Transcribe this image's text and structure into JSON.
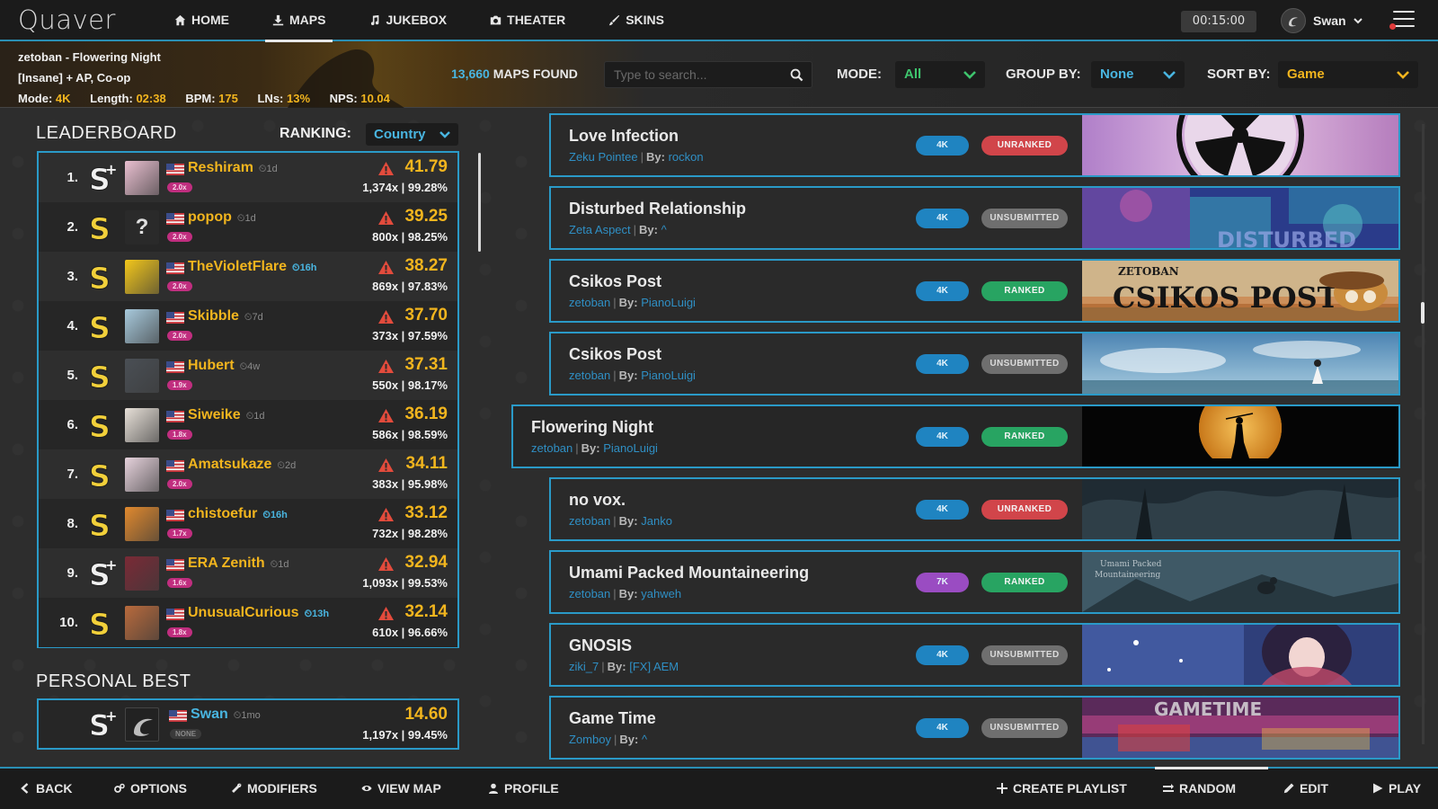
{
  "nav": {
    "logo": "Quaver",
    "items": [
      {
        "label": "HOME",
        "icon": "home-icon"
      },
      {
        "label": "MAPS",
        "icon": "download-icon"
      },
      {
        "label": "JUKEBOX",
        "icon": "music-icon"
      },
      {
        "label": "THEATER",
        "icon": "camera-icon"
      },
      {
        "label": "SKINS",
        "icon": "brush-icon"
      }
    ],
    "active": "MAPS",
    "timer": "00:15:00",
    "username": "Swan"
  },
  "map_info": {
    "title": "zetoban - Flowering Night",
    "difficulty": "[Insane] + AP, Co-op",
    "mode_label": "Mode:",
    "mode": "4K",
    "length_label": "Length:",
    "length": "02:38",
    "bpm_label": "BPM:",
    "bpm": "175",
    "lns_label": "LNs:",
    "lns": "13%",
    "nps_label": "NPS:",
    "nps": "10.04"
  },
  "filters": {
    "maps_found_count": "13,660",
    "maps_found_label": "MAPS FOUND",
    "search_placeholder": "Type to search...",
    "mode_label": "MODE:",
    "mode_value": "All",
    "group_label": "GROUP BY:",
    "group_value": "None",
    "sort_label": "SORT BY:",
    "sort_value": "Game"
  },
  "leaderboard": {
    "title": "LEADERBOARD",
    "ranking_label": "RANKING:",
    "ranking_value": "Country",
    "rows": [
      {
        "pos": "1.",
        "grade": "S+",
        "name": "Reshiram",
        "time": "1d",
        "time_hi": false,
        "mod": "2.0x",
        "score": "41.79",
        "acc": "1,374x | 99.28%",
        "avatar": "#e9bfd0"
      },
      {
        "pos": "2.",
        "grade": "S",
        "name": "popop",
        "time": "1d",
        "time_hi": false,
        "mod": "2.0x",
        "score": "39.25",
        "acc": "800x | 98.25%",
        "avatar": "unknown"
      },
      {
        "pos": "3.",
        "grade": "S",
        "name": "TheVioletFlare",
        "time": "16h",
        "time_hi": true,
        "mod": "2.0x",
        "score": "38.27",
        "acc": "869x | 97.83%",
        "avatar": "#f3c71b"
      },
      {
        "pos": "4.",
        "grade": "S",
        "name": "Skibble",
        "time": "7d",
        "time_hi": false,
        "mod": "2.0x",
        "score": "37.70",
        "acc": "373x | 97.59%",
        "avatar": "#a7c9dc"
      },
      {
        "pos": "5.",
        "grade": "S",
        "name": "Hubert",
        "time": "4w",
        "time_hi": false,
        "mod": "1.9x",
        "score": "37.31",
        "acc": "550x | 98.17%",
        "avatar": "#4a4f55"
      },
      {
        "pos": "6.",
        "grade": "S",
        "name": "Siweike",
        "time": "1d",
        "time_hi": false,
        "mod": "1.8x",
        "score": "36.19",
        "acc": "586x | 98.59%",
        "avatar": "#e7e0d8"
      },
      {
        "pos": "7.",
        "grade": "S",
        "name": "Amatsukaze",
        "time": "2d",
        "time_hi": false,
        "mod": "2.0x",
        "score": "34.11",
        "acc": "383x | 95.98%",
        "avatar": "#e6d2dc"
      },
      {
        "pos": "8.",
        "grade": "S",
        "name": "chistoefur",
        "time": "16h",
        "time_hi": true,
        "mod": "1.7x",
        "score": "33.12",
        "acc": "732x | 98.28%",
        "avatar": "#e0892e"
      },
      {
        "pos": "9.",
        "grade": "S+",
        "name": "ERA Zenith",
        "time": "1d",
        "time_hi": false,
        "mod": "1.6x",
        "score": "32.94",
        "acc": "1,093x | 99.53%",
        "avatar": "#7a2a36"
      },
      {
        "pos": "10.",
        "grade": "S",
        "name": "UnusualCurious",
        "time": "13h",
        "time_hi": true,
        "mod": "1.8x",
        "score": "32.14",
        "acc": "610x | 96.66%",
        "avatar": "#b86a3c"
      }
    ]
  },
  "personal_best": {
    "title": "PERSONAL BEST",
    "grade": "S+",
    "name": "Swan",
    "time": "1mo",
    "mod": "NONE",
    "score": "14.60",
    "acc": "1,197x | 99.45%"
  },
  "maps": [
    {
      "title": "Love Infection",
      "artist": "Zeku Pointee",
      "by_label": "By:",
      "creator": "rockon",
      "keys": "4K",
      "status": "UNRANKED",
      "banner": "radiation"
    },
    {
      "title": "Disturbed Relationship",
      "artist": "Zeta Aspect",
      "by_label": "By:",
      "creator": "^",
      "keys": "4K",
      "status": "UNSUBMITTED",
      "banner": "disturbed"
    },
    {
      "title": "Csikos Post",
      "artist": "zetoban",
      "by_label": "By:",
      "creator": "PianoLuigi",
      "keys": "4K",
      "status": "RANKED",
      "banner": "csikos",
      "banner_text_top": "ZETOBAN",
      "banner_text_main": "CSIKOS POST"
    },
    {
      "title": "Csikos Post",
      "artist": "zetoban",
      "by_label": "By:",
      "creator": "PianoLuigi",
      "keys": "4K",
      "status": "UNSUBMITTED",
      "banner": "sky"
    },
    {
      "title": "Flowering Night",
      "artist": "zetoban",
      "by_label": "By:",
      "creator": "PianoLuigi",
      "keys": "4K",
      "status": "RANKED",
      "banner": "moon",
      "selected": true
    },
    {
      "title": "no vox.",
      "artist": "zetoban",
      "by_label": "By:",
      "creator": "Janko",
      "keys": "4K",
      "status": "UNRANKED",
      "banner": "forest"
    },
    {
      "title": "Umami Packed Mountaineering",
      "artist": "zetoban",
      "by_label": "By:",
      "creator": "yahweh",
      "keys": "7K",
      "status": "RANKED",
      "banner": "mountain"
    },
    {
      "title": "GNOSIS",
      "artist": "ziki_7",
      "by_label": "By:",
      "creator": "[FX] AEM",
      "keys": "4K",
      "status": "UNSUBMITTED",
      "banner": "anime"
    },
    {
      "title": "Game Time",
      "artist": "Zomboy",
      "by_label": "By:",
      "creator": "^",
      "keys": "4K",
      "status": "UNSUBMITTED",
      "banner": "gametime",
      "banner_text_main": "GAMETIME"
    }
  ],
  "bottom": {
    "left": [
      {
        "label": "BACK",
        "icon": "chevron-left-icon"
      },
      {
        "label": "OPTIONS",
        "icon": "gears-icon"
      },
      {
        "label": "MODIFIERS",
        "icon": "wrench-icon"
      },
      {
        "label": "VIEW MAP",
        "icon": "eye-icon"
      },
      {
        "label": "PROFILE",
        "icon": "user-icon"
      }
    ],
    "right": [
      {
        "label": "CREATE PLAYLIST",
        "icon": "plus-icon"
      },
      {
        "label": "RANDOM",
        "icon": "shuffle-icon"
      },
      {
        "label": "EDIT",
        "icon": "pencil-icon"
      },
      {
        "label": "PLAY",
        "icon": "play-icon"
      }
    ]
  },
  "colors": {
    "accent_blue": "#2a9ac8",
    "gold": "#f2b51e",
    "ranked": "#28a462",
    "unranked": "#d1454a",
    "unsubmitted": "#6f6f6f",
    "keys_4k": "#1f84c1",
    "keys_7k": "#9a4cc2"
  }
}
